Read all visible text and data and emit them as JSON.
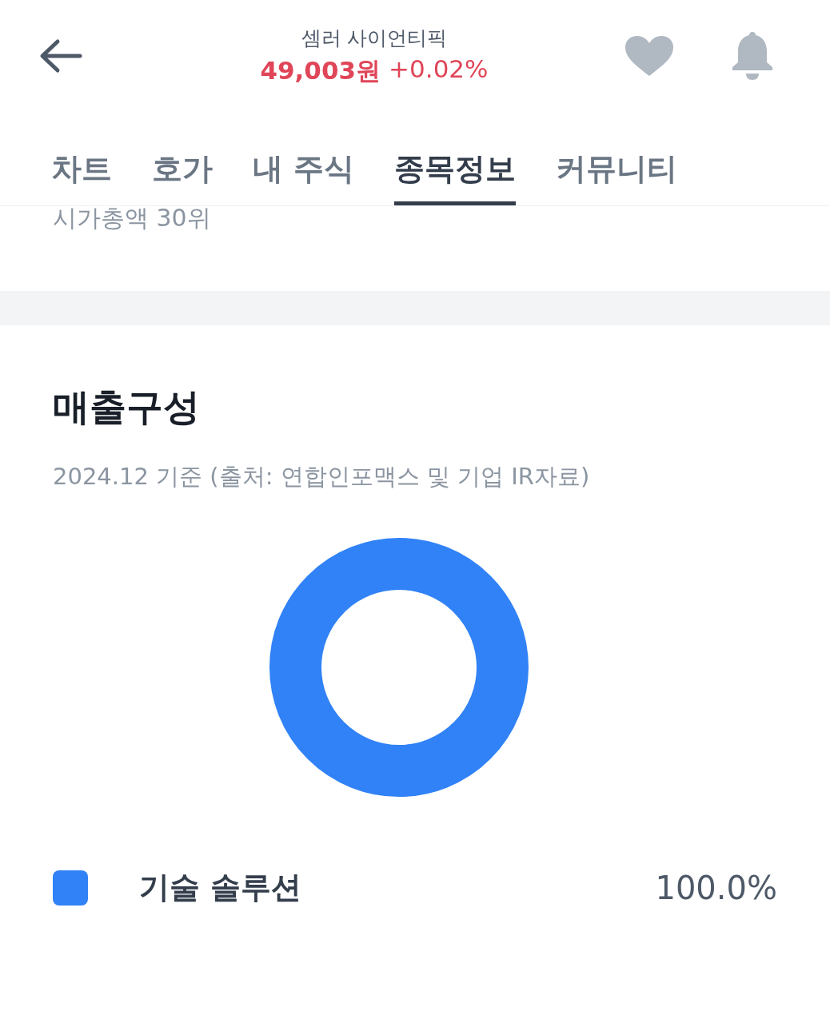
{
  "header": {
    "stock_name": "셈러 사이언티픽",
    "price": "49,003원",
    "change": "+0.02%"
  },
  "tabs": [
    {
      "label": "차트",
      "selected": false
    },
    {
      "label": "호가",
      "selected": false
    },
    {
      "label": "내 주식",
      "selected": false
    },
    {
      "label": "종목정보",
      "selected": true
    },
    {
      "label": "커뮤니티",
      "selected": false
    }
  ],
  "market_cap_rank": "시가총액 30위",
  "revenue": {
    "title": "매출구성",
    "subtitle": "2024.12 기준 (출처: 연합인포맥스 및 기업 IR자료)",
    "legend": [
      {
        "label": "기술 솔루션",
        "value": "100.0%",
        "color": "#3182f6"
      }
    ]
  }
}
